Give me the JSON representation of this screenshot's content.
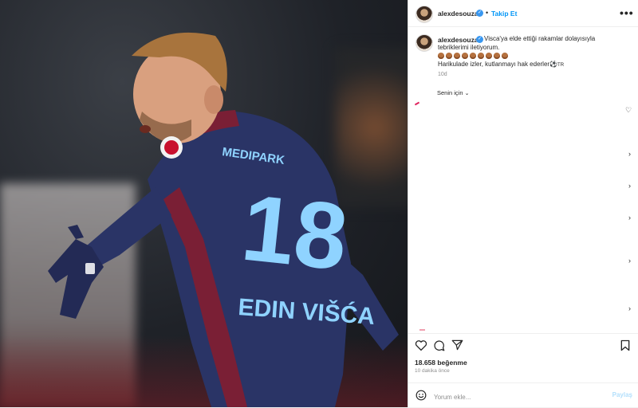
{
  "post": {
    "username": "alexdesouza",
    "follow_label": "Takip Et",
    "more_label": "•••",
    "caption_line1": "Visca'ya elde ettiği rakamlar dolayısıyla",
    "caption_line2": "tebriklerimi iletiyorum.",
    "caption_line3": "Harikulade izler, kutlanmayı hak ederler",
    "caption_suffix": "TR",
    "emoji_count": 9,
    "caption_time": "10d",
    "for_you_label": "Senin için",
    "likes": "18.658 beğenme",
    "time_ago": "10 dakika önce",
    "comment_placeholder": "Yorum ekle...",
    "post_button": "Paylaş"
  },
  "photo": {
    "jersey_name": "EDIN VIŠĆA",
    "jersey_number": "18",
    "jersey_sponsor": "MEDIPARK",
    "colors": {
      "jersey_navy": "#2a3466",
      "jersey_maroon": "#7a1f35",
      "number_blue": "#8fd3ff"
    }
  },
  "colors": {
    "accent": "#0095f6",
    "verified": "#3897f0",
    "muted": "#8e8e8e",
    "border": "#dbdbdb"
  }
}
